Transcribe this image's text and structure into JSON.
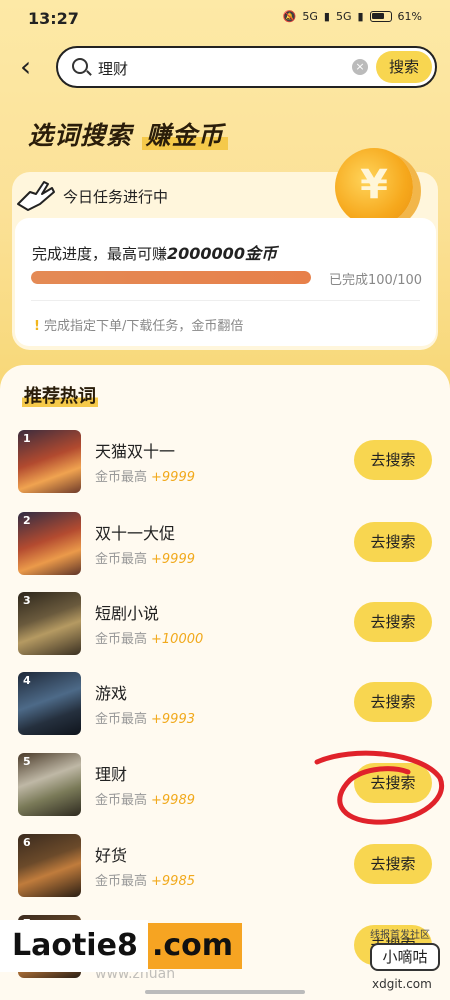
{
  "status_bar": {
    "time": "13:27",
    "signal1": "5G",
    "signal2": "5G",
    "battery": "61%"
  },
  "search": {
    "query": "理财",
    "button": "搜索"
  },
  "banner": {
    "title_part1": "选词搜索",
    "title_part2": "赚金币",
    "coin_symbol": "¥"
  },
  "task": {
    "title": "今日任务进行中",
    "progress_text": "完成进度，最高可赚",
    "progress_amount": "2000000金币",
    "progress_fraction": 1.0,
    "progress_count": "已完成100/100",
    "tip": "完成指定下单/下载任务，金币翻倍"
  },
  "list": {
    "title": "推荐热词",
    "reward_prefix": "金币最高",
    "items": [
      {
        "rank": "1",
        "name": "天猫双十一",
        "reward_prefix": "金币最高",
        "reward": "+9999",
        "button": "去搜索"
      },
      {
        "rank": "2",
        "name": "双十一大促",
        "reward_prefix": "金币最高",
        "reward": "+9999",
        "button": "去搜索"
      },
      {
        "rank": "3",
        "name": "短剧小说",
        "reward_prefix": "金币最高",
        "reward": "+10000",
        "button": "去搜索"
      },
      {
        "rank": "4",
        "name": "游戏",
        "reward_prefix": "金币最高",
        "reward": "+9993",
        "button": "去搜索"
      },
      {
        "rank": "5",
        "name": "理财",
        "reward_prefix": "金币最高",
        "reward": "+9989",
        "button": "去搜索"
      },
      {
        "rank": "6",
        "name": "好货",
        "reward_prefix": "金币最高",
        "reward": "+9985",
        "button": "去搜索"
      },
      {
        "rank": "7",
        "name": "",
        "reward_prefix": "",
        "reward": "",
        "button": "去搜索"
      }
    ]
  },
  "watermark": {
    "logo_left": "Laotie8",
    "logo_right": ".com",
    "faded_url": "www.zhuan",
    "site_note": "线报首发社区",
    "badge": "小嘀咕",
    "domain": "xdgit.com"
  },
  "colors": {
    "accent": "#f8d650",
    "reward": "#f1a91c",
    "progress": "#e48a55",
    "annotation": "#e0222a"
  }
}
